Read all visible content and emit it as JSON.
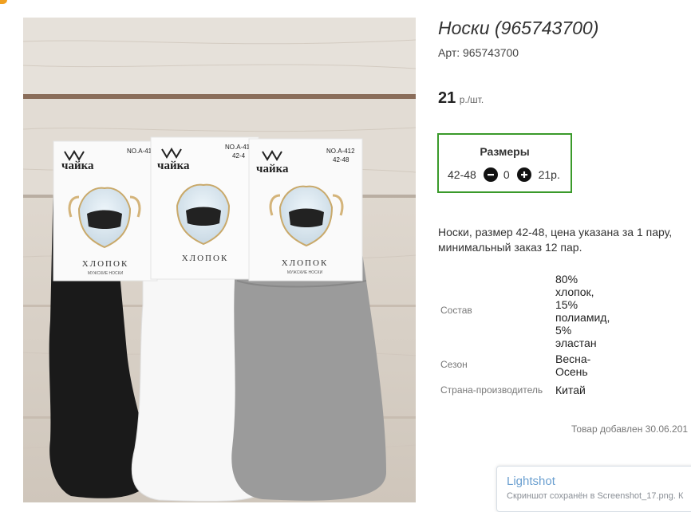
{
  "product": {
    "title": "Носки (965743700)",
    "sku": "Арт: 965743700",
    "price_value": "21",
    "price_unit": "р./шт."
  },
  "sizes": {
    "title": "Размеры",
    "rows": [
      {
        "size": "42-48",
        "quantity": "0",
        "price": "21р."
      }
    ]
  },
  "description": "Носки, размер 42-48, цена указана за 1 пару, минимальный заказ 12 пар.",
  "specs": [
    {
      "label": "Состав",
      "value_lines": [
        "80%",
        "хлопок,",
        "15%",
        "полиамид,",
        "5%",
        "эластан"
      ]
    },
    {
      "label": "Сезон",
      "value_lines": [
        "Весна-",
        "Осень"
      ]
    },
    {
      "label": "Страна-производитель",
      "value_lines": [
        "Китай"
      ]
    }
  ],
  "added_text": "Товар добавлен 30.06.201",
  "photo": {
    "brand": "чайка",
    "product_word": "ХЛОПОК",
    "sub_word": "МУЖСКИЕ НОСКИ",
    "model": "NO.A-412",
    "size": "42-48",
    "model_partial": "NO.A-41",
    "size_partial": "42-4"
  },
  "toast": {
    "title": "Lightshot",
    "message": "Скриншот сохранён в Screenshot_17.png. К"
  },
  "colors": {
    "accent_border": "#3a9a2a",
    "toast_title": "#6a9fd0"
  }
}
